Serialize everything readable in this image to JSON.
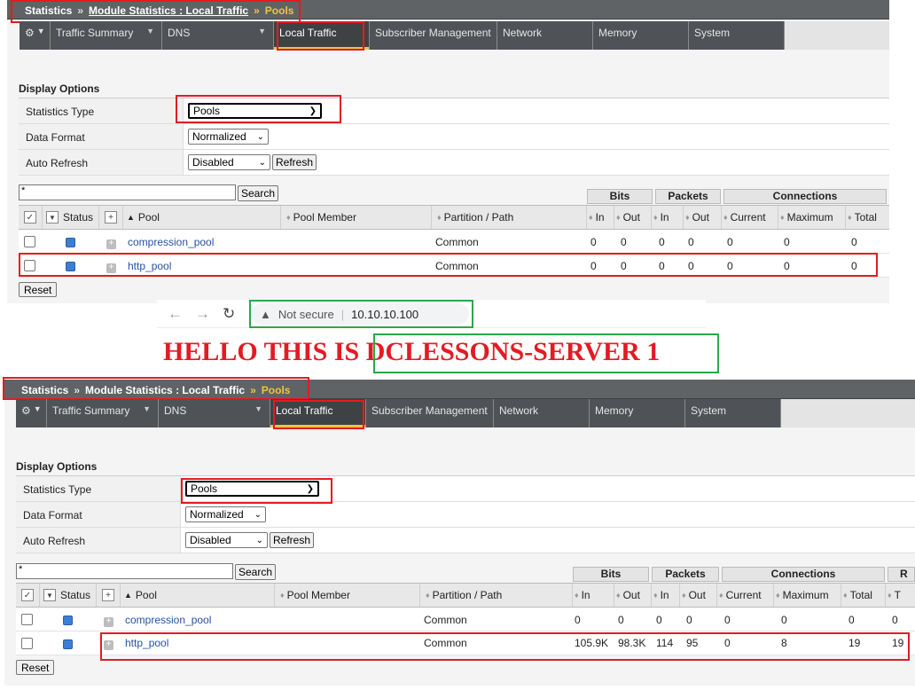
{
  "breadcrumb": {
    "root": "Statistics",
    "sep": "»",
    "module": "Module Statistics : Local Traffic",
    "current": "Pools"
  },
  "tabs": [
    {
      "label": "",
      "icon": "gear-icon",
      "dropdown": true
    },
    {
      "label": "Traffic Summary",
      "dropdown": true
    },
    {
      "label": "DNS",
      "dropdown": true
    },
    {
      "label": "Local Traffic",
      "active": true
    },
    {
      "label": "Subscriber Management"
    },
    {
      "label": "Network"
    },
    {
      "label": "Memory"
    },
    {
      "label": "System"
    }
  ],
  "display_options": {
    "heading": "Display Options",
    "statistics_type": {
      "label": "Statistics Type",
      "value": "Pools"
    },
    "data_format": {
      "label": "Data Format",
      "value": "Normalized"
    },
    "auto_refresh": {
      "label": "Auto Refresh",
      "value": "Disabled",
      "button": "Refresh"
    }
  },
  "search": {
    "value": "*",
    "button": "Search"
  },
  "groups": {
    "bits": "Bits",
    "packets": "Packets",
    "connections": "Connections",
    "r": "R"
  },
  "columns": {
    "status": "Status",
    "pool": "Pool",
    "pool_member": "Pool Member",
    "partition": "Partition / Path",
    "in": "In",
    "out": "Out",
    "current": "Current",
    "maximum": "Maximum",
    "total": "Total",
    "t": "T"
  },
  "reset": "Reset",
  "panel1": {
    "rows": [
      {
        "name": "compression_pool",
        "partition": "Common",
        "bits_in": "0",
        "bits_out": "0",
        "pkts_in": "0",
        "pkts_out": "0",
        "current": "0",
        "maximum": "0",
        "total": "0"
      },
      {
        "name": "http_pool",
        "partition": "Common",
        "bits_in": "0",
        "bits_out": "0",
        "pkts_in": "0",
        "pkts_out": "0",
        "current": "0",
        "maximum": "0",
        "total": "0"
      }
    ]
  },
  "browser": {
    "warning": "Not secure",
    "url": "10.10.10.100"
  },
  "hello": {
    "prefix": "HELLO THIS IS ",
    "server": "DCLESSONS-SERVER 1"
  },
  "panel2": {
    "rows": [
      {
        "name": "compression_pool",
        "partition": "Common",
        "bits_in": "0",
        "bits_out": "0",
        "pkts_in": "0",
        "pkts_out": "0",
        "current": "0",
        "maximum": "0",
        "total": "0",
        "extra": "0"
      },
      {
        "name": "http_pool",
        "partition": "Common",
        "bits_in": "105.9K",
        "bits_out": "98.3K",
        "pkts_in": "114",
        "pkts_out": "95",
        "current": "0",
        "maximum": "8",
        "total": "19",
        "extra": "19"
      }
    ]
  }
}
